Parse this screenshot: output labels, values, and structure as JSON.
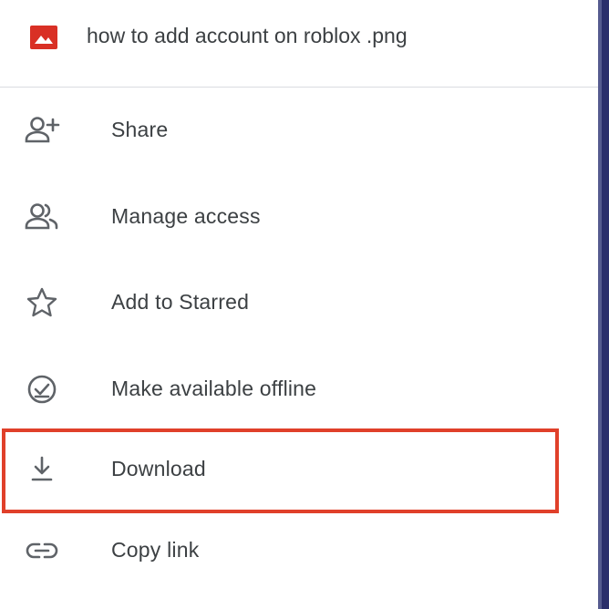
{
  "file": {
    "name": "how to add account on roblox .png",
    "icon": "image-file-icon",
    "icon_color": "#d93025"
  },
  "menu": {
    "items": [
      {
        "label": "Share",
        "icon": "person-add-icon"
      },
      {
        "label": "Manage access",
        "icon": "people-icon"
      },
      {
        "label": "Add to Starred",
        "icon": "star-outline-icon"
      },
      {
        "label": "Make available offline",
        "icon": "offline-check-icon"
      },
      {
        "label": "Download",
        "icon": "download-icon"
      },
      {
        "label": "Copy link",
        "icon": "link-icon"
      }
    ]
  },
  "highlight": {
    "target": "Download",
    "color": "#e0402a"
  },
  "colors": {
    "text": "#3c4043",
    "icon": "#5f6368",
    "divider": "#dadce0"
  }
}
